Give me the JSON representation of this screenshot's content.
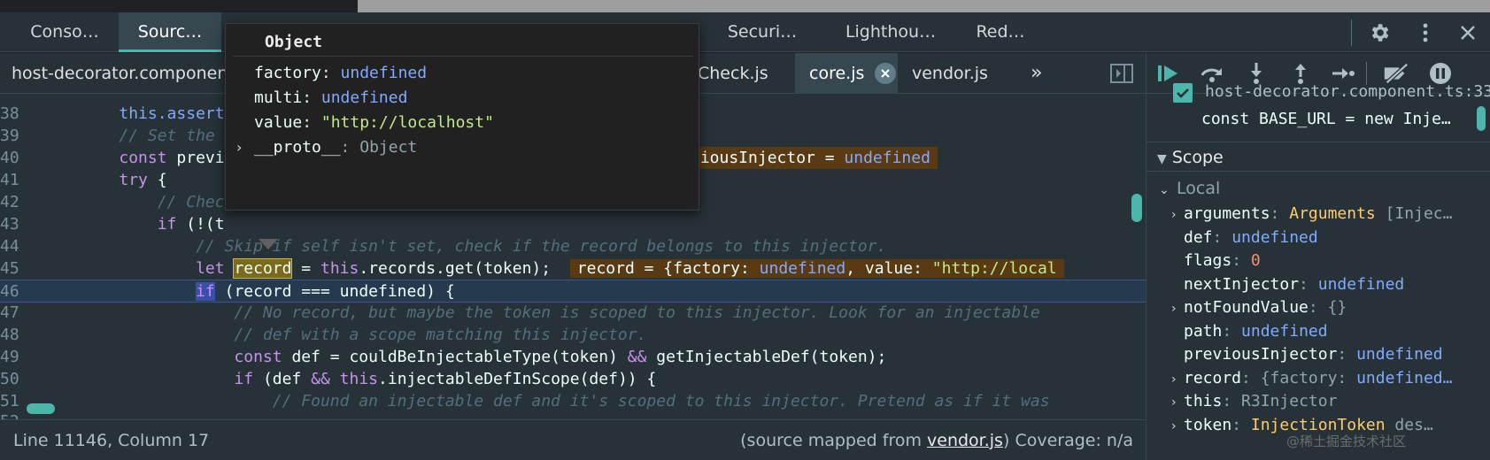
{
  "panel_tabs": [
    {
      "label": "Conso…",
      "active": false
    },
    {
      "label": "Sourc…",
      "active": true
    },
    {
      "label": "Securi…",
      "active": false
    },
    {
      "label": "Lighthou…",
      "active": false
    },
    {
      "label": "Red…",
      "active": false
    }
  ],
  "file_tabs": [
    {
      "label": "host-decorator.componen",
      "active": false
    },
    {
      "label": "Check.js",
      "active": false
    },
    {
      "label": "core.js",
      "active": true
    },
    {
      "label": "vendor.js",
      "active": false
    }
  ],
  "more_tabs_icon": "»",
  "code": {
    "line38": {
      "n": "38",
      "t1": "this.assert"
    },
    "line39": {
      "n": "39",
      "t1": "// Set the"
    },
    "line40": {
      "n": "40",
      "t1": "const",
      "t2": " previ",
      "inl_name": "viousInjector = ",
      "inl_val": "undefined"
    },
    "line41": {
      "n": "41",
      "t1": "try",
      "t2": " {"
    },
    "line42": {
      "n": "42",
      "t1": "// Chec"
    },
    "line43": {
      "n": "43",
      "t1": "if",
      "t2": " (!(t"
    },
    "line44": {
      "n": "44",
      "t1": "// Skip if self isn't set, check if the record belongs to this injector."
    },
    "line45": {
      "n": "45",
      "t_let": "let",
      "t_var": "record",
      "t_rest1": " = ",
      "t_this": "this",
      "t_rest2": ".records.get(token);  ",
      "inl_a": "record = {factory: ",
      "inl_b": "undefined",
      "inl_c": ", value: ",
      "inl_d": "\"http://local"
    },
    "line46": {
      "n": "46",
      "t_if": "if",
      "t_rest": " (record === undefined) {"
    },
    "line47": {
      "n": "47",
      "t1": "// No record, but maybe the token is scoped to this injector. Look for an injectable"
    },
    "line48": {
      "n": "48",
      "t1": "// def with a scope matching this injector."
    },
    "line49": {
      "n": "49",
      "t_const": "const",
      "t_a": " def = couldBeInjectableType(token) ",
      "t_and": "&&",
      "t_b": " getInjectableDef(token);"
    },
    "line50": {
      "n": "50",
      "t_if": "if",
      "t_a": " (def ",
      "t_and": "&&",
      "t_this": " this",
      "t_b": ".injectableDefInScope(def)) {"
    },
    "line51": {
      "n": "51",
      "t1": "// Found an injectable def and it's scoped to this injector. Pretend as if it was"
    },
    "line52": {
      "n": "52"
    }
  },
  "popover": {
    "title": "Object",
    "rows": [
      {
        "name": "factory",
        "value": "undefined"
      },
      {
        "name": "multi",
        "value": "undefined"
      },
      {
        "name": "value",
        "value": "\"http://localhost\""
      }
    ],
    "proto": {
      "name": "__proto__",
      "value": "Object"
    }
  },
  "status": {
    "position": "Line 11146, Column 17",
    "mapped_prefix": "(source mapped from ",
    "mapped_link": "vendor.js",
    "mapped_suffix": ")",
    "coverage": "Coverage: n/a"
  },
  "breakpoint": {
    "file": "host-decorator.component.ts:33",
    "code": "const BASE_URL = new Inje…"
  },
  "scope": {
    "title": "Scope",
    "local_label": "Local",
    "vars": [
      {
        "name": "arguments",
        "value": "Arguments",
        "extra": " [Injec…",
        "expandable": true,
        "kind": "class"
      },
      {
        "name": "def",
        "value": "undefined",
        "expandable": false,
        "kind": "und"
      },
      {
        "name": "flags",
        "value": "0",
        "expandable": false,
        "kind": "num"
      },
      {
        "name": "nextInjector",
        "value": "undefined",
        "expandable": false,
        "kind": "und"
      },
      {
        "name": "notFoundValue",
        "value": "{}",
        "expandable": true,
        "kind": "dim"
      },
      {
        "name": "path",
        "value": "undefined",
        "expandable": false,
        "kind": "und"
      },
      {
        "name": "previousInjector",
        "value": "undefined",
        "expandable": false,
        "kind": "und"
      },
      {
        "name": "record",
        "value": "{factory: ",
        "extra": "undefined…",
        "expandable": true,
        "kind": "dim"
      },
      {
        "name": "this",
        "value": "R3Injector",
        "expandable": true,
        "kind": "dim"
      },
      {
        "name": "token",
        "value": "InjectionToken",
        "extra": " des…",
        "expandable": true,
        "kind": "class"
      }
    ]
  },
  "watermark": "@稀土掘金技术社区",
  "colors": {
    "accent": "#4db6ac",
    "background": "#263238",
    "undefined": "#82aaff",
    "string": "#c3e88d"
  }
}
